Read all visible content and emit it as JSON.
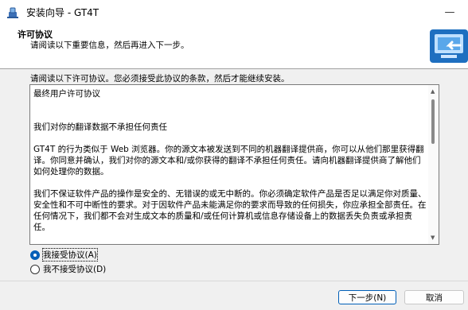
{
  "window": {
    "title": "安装向导 - GT4T",
    "minimize_glyph": "—"
  },
  "header": {
    "title": "许可协议",
    "subtitle": "请阅读以下重要信息，然后再进入下一步。",
    "graphic": "computer-install-icon"
  },
  "intro": "请阅读以下许可协议。您必须接受此协议的条款，然后才能继续安装。",
  "license": {
    "lines": [
      "最终用户许可协议",
      "我们对你的翻译数据不承担任何责任",
      "GT4T 的行为类似于 Web 浏览器。你的源文本被发送到不同的机器翻译提供商，你可以从他们那里获得翻译。你同意并确认，我们对你的源文本和/或你获得的翻译不承担任何责任。请向机器翻译提供商了解他们如何处理你的数据。",
      "我们不保证软件产品的操作是安全的、无错误的或无中断的。你必须确定软件产品是否足以满足你对质量、安全性和不可中断性的要求。对于因软件产品未能满足你的要求而导致的任何损失，你应承担全部责任。在任何情况下，我们都不会对生成文本的质量和/或任何计算机或信息存储设备上的数据丢失负责或承担责任。"
    ]
  },
  "options": {
    "accept_label": "我接受协议(A)",
    "decline_label": "我不接受协议(D)",
    "selected": "accept"
  },
  "buttons": {
    "next_label": "下一步(N)",
    "cancel_label": "取消"
  },
  "colors": {
    "accent": "#005fb8",
    "header_bg": "#ffffff",
    "dialog_bg": "#f0f0f0"
  }
}
